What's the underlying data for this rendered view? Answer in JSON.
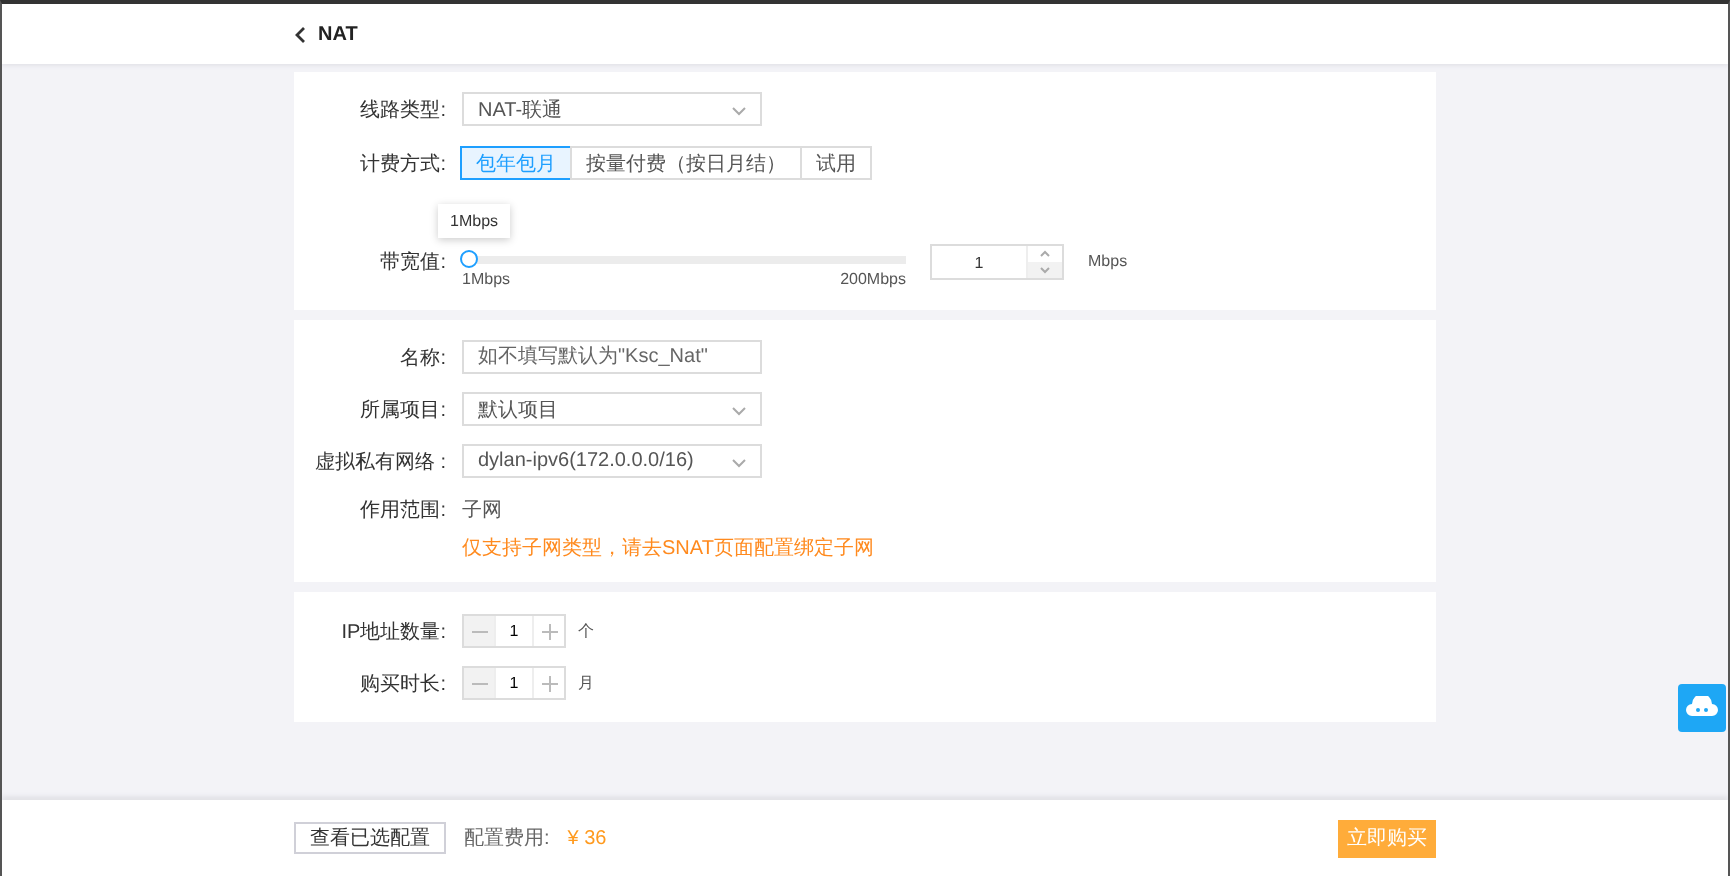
{
  "header": {
    "title": "NAT"
  },
  "basic": {
    "line_type": {
      "label": "线路类型:",
      "value": "NAT-联通"
    },
    "billing": {
      "label": "计费方式:",
      "options": [
        {
          "label": "包年包月",
          "selected": true
        },
        {
          "label": "按量付费（按日月结）",
          "selected": false
        },
        {
          "label": "试用",
          "selected": false
        }
      ]
    },
    "bandwidth": {
      "label": "带宽值:",
      "tooltip": "1Mbps",
      "level": 0,
      "min_label": "1Mbps",
      "max_label": "200Mbps",
      "value": "1",
      "unit": "Mbps"
    }
  },
  "details": {
    "name": {
      "label": "名称:",
      "placeholder": "如不填写默认为\"Ksc_Nat\""
    },
    "project": {
      "label": "所属项目:",
      "value": "默认项目"
    },
    "vpc": {
      "label": "虚拟私有网络 :",
      "value": "dylan-ipv6(172.0.0.0/16)"
    },
    "scope": {
      "label": "作用范围:",
      "value": "子网",
      "note": "仅支持子网类型，请去SNAT页面配置绑定子网"
    }
  },
  "quantity": [
    {
      "label": "IP地址数量:",
      "value": "1",
      "unit": "个"
    },
    {
      "label": "购买时长:",
      "value": "1",
      "unit": "月"
    }
  ],
  "footer": {
    "view_button": "查看已选配置",
    "cost_label": "配置费用:",
    "price": "¥ 36",
    "buy_button": "立即购买"
  }
}
